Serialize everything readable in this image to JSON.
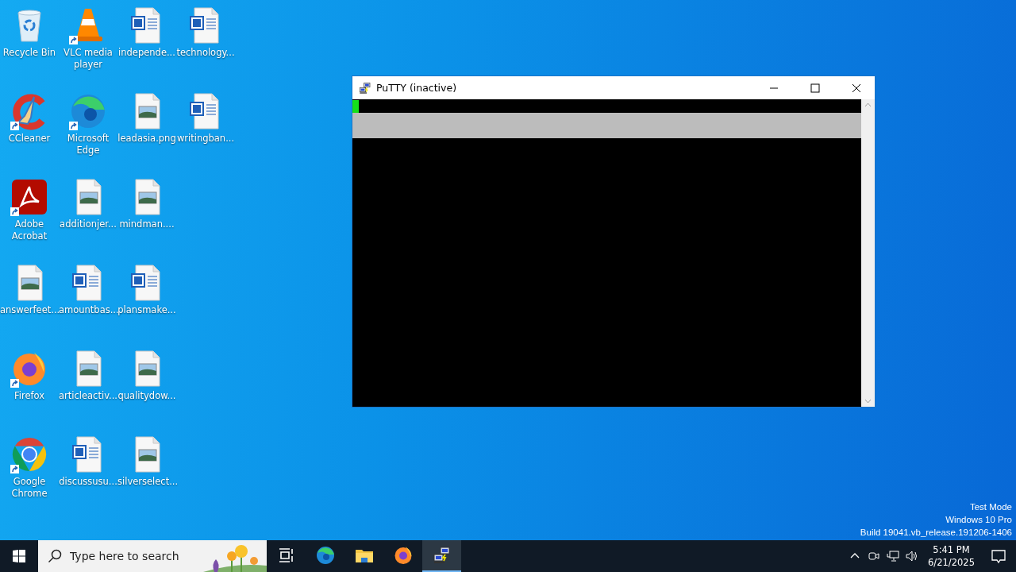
{
  "desktop_icons": [
    {
      "label": "Recycle Bin",
      "kind": "recycle",
      "shortcut": false
    },
    {
      "label": "CCleaner",
      "kind": "ccleaner",
      "shortcut": true
    },
    {
      "label": "Adobe Acrobat",
      "kind": "acrobat",
      "shortcut": true
    },
    {
      "label": "answerfeet...",
      "kind": "image",
      "shortcut": false
    },
    {
      "label": "Firefox",
      "kind": "firefox",
      "shortcut": true
    },
    {
      "label": "Google Chrome",
      "kind": "chrome",
      "shortcut": true
    },
    {
      "label": "VLC media player",
      "kind": "vlc",
      "shortcut": true
    },
    {
      "label": "Microsoft Edge",
      "kind": "edge",
      "shortcut": true
    },
    {
      "label": "additionjer...",
      "kind": "image",
      "shortcut": false
    },
    {
      "label": "amountbas...",
      "kind": "word",
      "shortcut": false
    },
    {
      "label": "articleactiv...",
      "kind": "image",
      "shortcut": false
    },
    {
      "label": "discussusu...",
      "kind": "word",
      "shortcut": false
    },
    {
      "label": "independe...",
      "kind": "word",
      "shortcut": false
    },
    {
      "label": "leadasia.png",
      "kind": "image",
      "shortcut": false
    },
    {
      "label": "mindman....",
      "kind": "image",
      "shortcut": false
    },
    {
      "label": "plansmake...",
      "kind": "word",
      "shortcut": false
    },
    {
      "label": "qualitydow...",
      "kind": "image",
      "shortcut": false
    },
    {
      "label": "silverselect...",
      "kind": "image",
      "shortcut": false
    },
    {
      "label": "technology...",
      "kind": "word",
      "shortcut": false
    },
    {
      "label": "writingban...",
      "kind": "word",
      "shortcut": false
    }
  ],
  "window": {
    "title": "PuTTY (inactive)"
  },
  "system_watermark": [
    "Test Mode",
    "Windows 10 Pro",
    "Build 19041.vb_release.191206-1406"
  ],
  "taskbar": {
    "search": {
      "placeholder": "Type here to search"
    },
    "apps": [
      {
        "kind": "taskview",
        "selected": false
      },
      {
        "kind": "edge",
        "selected": false
      },
      {
        "kind": "explorer",
        "selected": false
      },
      {
        "kind": "firefox",
        "selected": false
      },
      {
        "kind": "putty",
        "selected": true
      }
    ],
    "clock": {
      "time": "5:41 PM",
      "date": "6/21/2025"
    }
  }
}
